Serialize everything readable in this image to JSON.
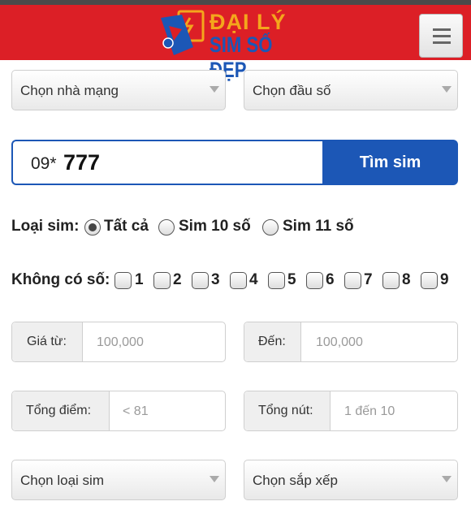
{
  "header": {
    "logo_line1": "ĐẠI LÝ",
    "logo_line2": "SIM SỐ ĐẸP",
    "colors": {
      "bar": "#dc1f26",
      "logo_orange": "#f4a61c",
      "logo_blue": "#1c57b6"
    },
    "menu_icon": "hamburger-icon"
  },
  "filters_top": {
    "network_select": "Chọn nhà mạng",
    "prefix_select": "Chọn đầu số"
  },
  "search": {
    "prefix": "09*",
    "bold_digits": "777",
    "button_label": "Tìm sim"
  },
  "sim_type": {
    "label": "Loại sim:",
    "options": [
      "Tất cả",
      "Sim 10 số",
      "Sim 11 số"
    ],
    "selected_index": 0
  },
  "exclude_digits": {
    "label": "Không có số:",
    "digits": [
      "1",
      "2",
      "3",
      "4",
      "5",
      "6",
      "7",
      "8",
      "9"
    ]
  },
  "price": {
    "from_label": "Giá từ:",
    "from_placeholder": "100,000",
    "to_label": "Đến:",
    "to_placeholder": "100,000"
  },
  "score": {
    "total_label": "Tổng điểm:",
    "total_placeholder": "< 81",
    "nut_label": "Tổng nút:",
    "nut_placeholder": "1 đến 10"
  },
  "filters_bottom": {
    "sim_kind_select": "Chọn loại sim",
    "sort_select": "Chọn sắp xếp"
  }
}
